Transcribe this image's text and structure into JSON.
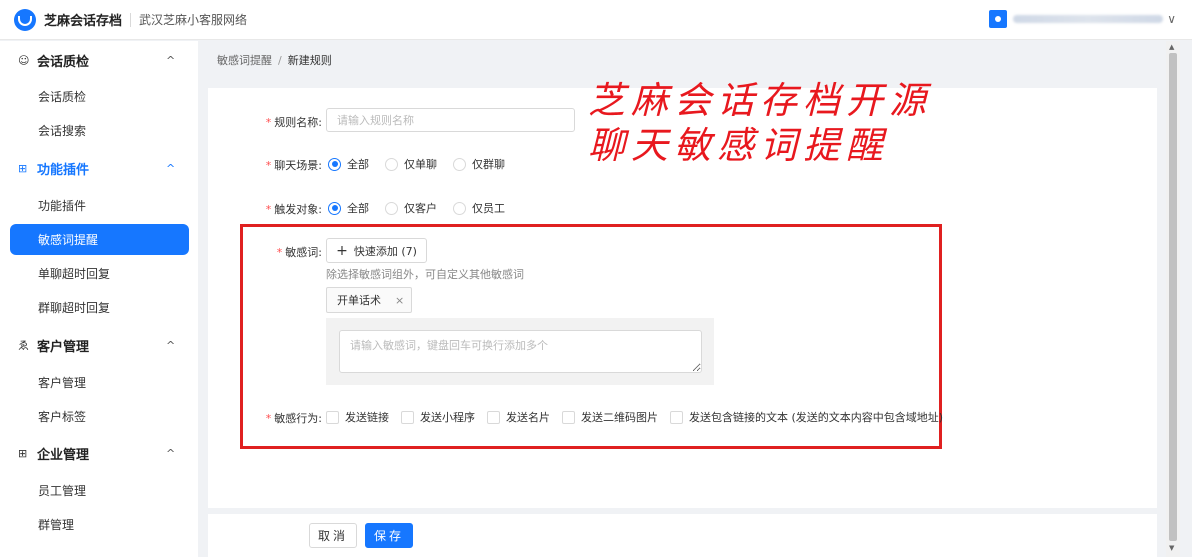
{
  "header": {
    "app_title": "芝麻会话存档",
    "company": "武汉芝麻小客服网络",
    "user_chevron": "∨"
  },
  "sidebar": {
    "groups": [
      {
        "label": "会话质检",
        "icon": "☺",
        "chevron": "^",
        "active": false
      },
      {
        "label": "功能插件",
        "icon": "⊞",
        "chevron": "^",
        "active": true
      },
      {
        "label": "客户管理",
        "icon": "ゑ",
        "chevron": "^",
        "active": false
      },
      {
        "label": "企业管理",
        "icon": "⊞",
        "chevron": "^",
        "active": false
      }
    ],
    "items": [
      {
        "label": "会话质检"
      },
      {
        "label": "会话搜索"
      },
      {
        "label": "功能插件"
      },
      {
        "label": "敏感词提醒",
        "active": true
      },
      {
        "label": "单聊超时回复"
      },
      {
        "label": "群聊超时回复"
      },
      {
        "label": "客户管理"
      },
      {
        "label": "客户标签"
      },
      {
        "label": "员工管理"
      },
      {
        "label": "群管理"
      }
    ]
  },
  "breadcrumb": {
    "parent": "敏感词提醒",
    "separator": "/",
    "current": "新建规则"
  },
  "form": {
    "rule_name": {
      "label": "规则名称:",
      "placeholder": "请输入规则名称",
      "value": ""
    },
    "chat_scene": {
      "label": "聊天场景:",
      "options": [
        "全部",
        "仅单聊",
        "仅群聊"
      ],
      "selected": "全部"
    },
    "trigger_target": {
      "label": "触发对象:",
      "options": [
        "全部",
        "仅客户",
        "仅员工"
      ],
      "selected": "全部"
    },
    "sensitive_words": {
      "label": "敏感词:",
      "quick_add_label": "快速添加 (7)",
      "hint": "除选择敏感词组外，可自定义其他敏感词",
      "tags": [
        "开单话术"
      ],
      "textarea_placeholder": "请输入敏感词，键盘回车可换行添加多个"
    },
    "sensitive_actions": {
      "label": "敏感行为:",
      "options": [
        "发送链接",
        "发送小程序",
        "发送名片",
        "发送二维码图片",
        "发送包含链接的文本 (发送的文本内容中包含域地址)"
      ]
    },
    "required_mark": "*"
  },
  "overlay": {
    "line1": "芝麻会话存档开源",
    "line2": "聊天敏感词提醒"
  },
  "footer": {
    "cancel_label": "取消",
    "save_label": "保存"
  },
  "colors": {
    "accent": "#1677ff",
    "highlight_box": "#e02020",
    "required": "#ff4d4f"
  }
}
